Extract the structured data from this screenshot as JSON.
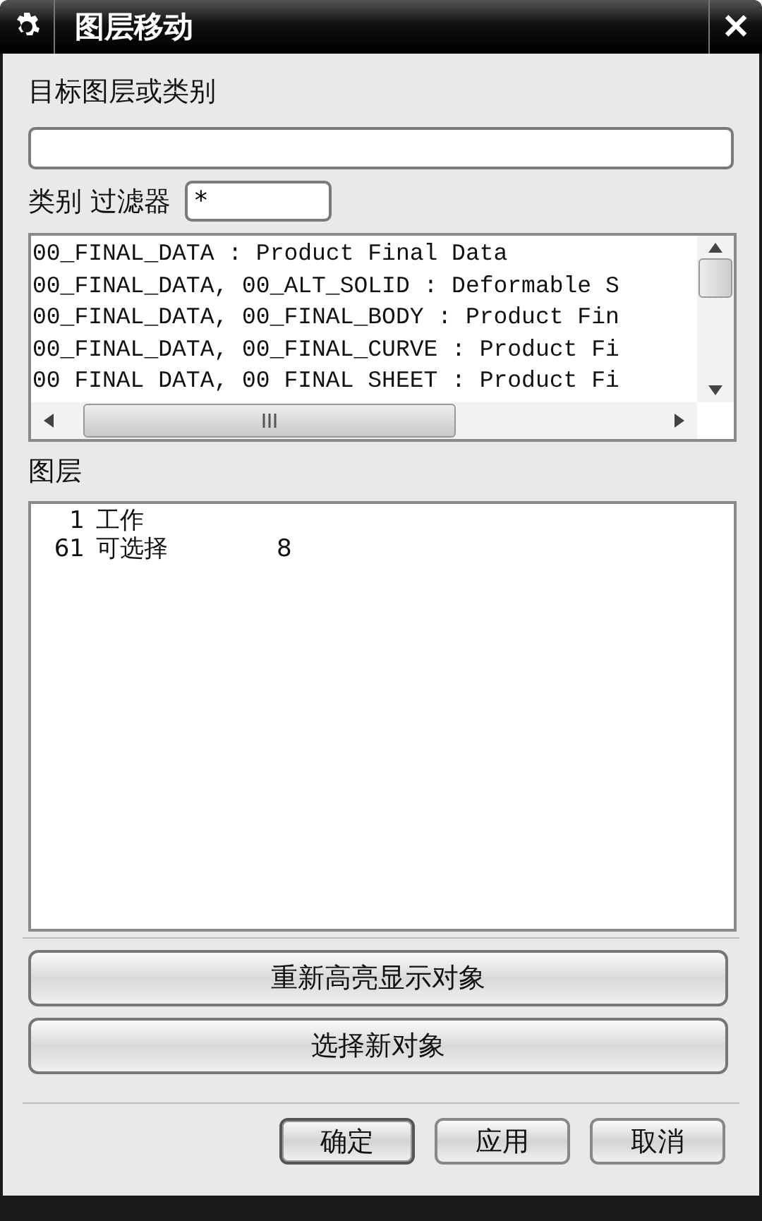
{
  "window": {
    "title": "图层移动",
    "close": "✕"
  },
  "target": {
    "label": "目标图层或类别"
  },
  "filter": {
    "label": "类别 过滤器",
    "value": "*"
  },
  "categories": [
    {
      "text": "00_FINAL_DATA : Product Final Data"
    },
    {
      "text": "00_FINAL_DATA, 00_ALT_SOLID : Deformable S"
    },
    {
      "text": "00_FINAL_DATA, 00_FINAL_BODY : Product Fin"
    },
    {
      "text": "00_FINAL_DATA, 00_FINAL_CURVE : Product Fi"
    },
    {
      "text": "00 FINAL DATA, 00 FINAL SHEET : Product Fi"
    }
  ],
  "layers": {
    "label": "图层",
    "rows": [
      {
        "number": "1",
        "name": "工作"
      },
      {
        "number": "61",
        "name": "可选择",
        "count": "8"
      }
    ]
  },
  "actions": [
    "重新高亮显示对象",
    "选择新对象"
  ],
  "buttons": [
    {
      "label": "确定",
      "kind": "default"
    },
    {
      "label": "应用",
      "kind": "normal"
    },
    {
      "label": "取消",
      "kind": "normal"
    }
  ]
}
